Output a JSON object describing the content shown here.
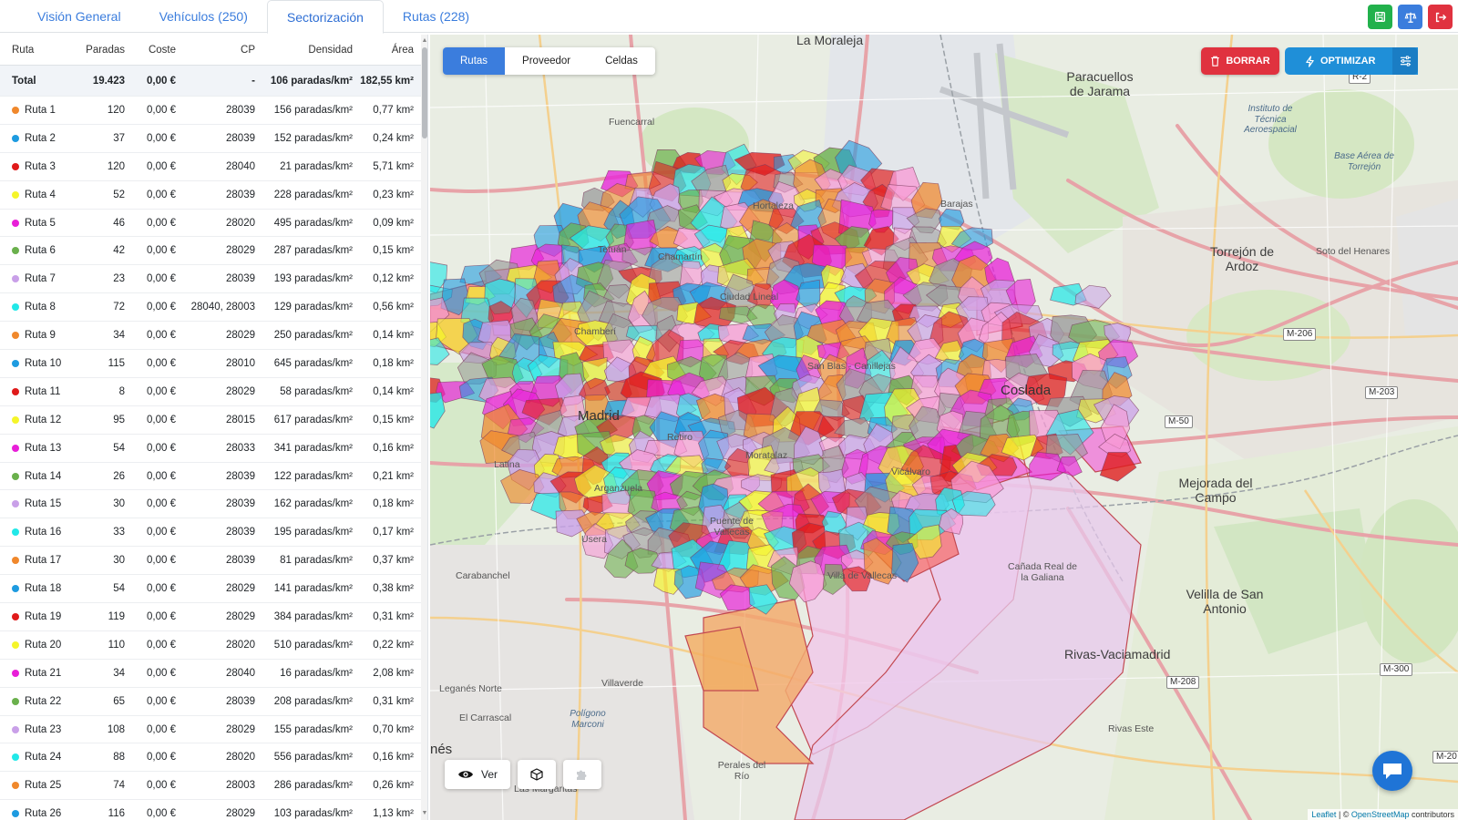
{
  "tabs": [
    {
      "label": "Visión General"
    },
    {
      "label": "Vehículos (250)"
    },
    {
      "label": "Sectorización"
    },
    {
      "label": "Rutas (228)"
    }
  ],
  "top_actions": [
    {
      "icon": "save-icon",
      "color": "#22b14c"
    },
    {
      "icon": "scale-icon",
      "color": "#3b7ddd"
    },
    {
      "icon": "logout-icon",
      "color": "#e0323f"
    }
  ],
  "table": {
    "headers": {
      "ruta": "Ruta",
      "paradas": "Paradas",
      "coste": "Coste",
      "cp": "CP",
      "densidad": "Densidad",
      "area": "Área"
    },
    "total": {
      "ruta": "Total",
      "paradas": "19.423",
      "coste": "0,00 €",
      "cp": "-",
      "densidad": "106 paradas/km²",
      "area": "182,55 km²"
    },
    "rows": [
      {
        "ruta": "Ruta 1",
        "color": "#f0882c",
        "paradas": "120",
        "coste": "0,00 €",
        "cp": "28039",
        "densidad": "156 paradas/km²",
        "area": "0,77 km²"
      },
      {
        "ruta": "Ruta 2",
        "color": "#1e9be0",
        "paradas": "37",
        "coste": "0,00 €",
        "cp": "28039",
        "densidad": "152 paradas/km²",
        "area": "0,24 km²"
      },
      {
        "ruta": "Ruta 3",
        "color": "#e01a1a",
        "paradas": "120",
        "coste": "0,00 €",
        "cp": "28040",
        "densidad": "21 paradas/km²",
        "area": "5,71 km²"
      },
      {
        "ruta": "Ruta 4",
        "color": "#f5f52a",
        "paradas": "52",
        "coste": "0,00 €",
        "cp": "28039",
        "densidad": "228 paradas/km²",
        "area": "0,23 km²"
      },
      {
        "ruta": "Ruta 5",
        "color": "#e81fd8",
        "paradas": "46",
        "coste": "0,00 €",
        "cp": "28020",
        "densidad": "495 paradas/km²",
        "area": "0,09 km²"
      },
      {
        "ruta": "Ruta 6",
        "color": "#6ab04c",
        "paradas": "42",
        "coste": "0,00 €",
        "cp": "28029",
        "densidad": "287 paradas/km²",
        "area": "0,15 km²"
      },
      {
        "ruta": "Ruta 7",
        "color": "#c9a0e8",
        "paradas": "23",
        "coste": "0,00 €",
        "cp": "28039",
        "densidad": "193 paradas/km²",
        "area": "0,12 km²"
      },
      {
        "ruta": "Ruta 8",
        "color": "#22e8e8",
        "paradas": "72",
        "coste": "0,00 €",
        "cp": "28040, 28003",
        "densidad": "129 paradas/km²",
        "area": "0,56 km²"
      },
      {
        "ruta": "Ruta 9",
        "color": "#f0882c",
        "paradas": "34",
        "coste": "0,00 €",
        "cp": "28029",
        "densidad": "250 paradas/km²",
        "area": "0,14 km²"
      },
      {
        "ruta": "Ruta 10",
        "color": "#1e9be0",
        "paradas": "115",
        "coste": "0,00 €",
        "cp": "28010",
        "densidad": "645 paradas/km²",
        "area": "0,18 km²"
      },
      {
        "ruta": "Ruta 11",
        "color": "#e01a1a",
        "paradas": "8",
        "coste": "0,00 €",
        "cp": "28029",
        "densidad": "58 paradas/km²",
        "area": "0,14 km²"
      },
      {
        "ruta": "Ruta 12",
        "color": "#f5f52a",
        "paradas": "95",
        "coste": "0,00 €",
        "cp": "28015",
        "densidad": "617 paradas/km²",
        "area": "0,15 km²"
      },
      {
        "ruta": "Ruta 13",
        "color": "#e81fd8",
        "paradas": "54",
        "coste": "0,00 €",
        "cp": "28033",
        "densidad": "341 paradas/km²",
        "area": "0,16 km²"
      },
      {
        "ruta": "Ruta 14",
        "color": "#6ab04c",
        "paradas": "26",
        "coste": "0,00 €",
        "cp": "28039",
        "densidad": "122 paradas/km²",
        "area": "0,21 km²"
      },
      {
        "ruta": "Ruta 15",
        "color": "#c9a0e8",
        "paradas": "30",
        "coste": "0,00 €",
        "cp": "28039",
        "densidad": "162 paradas/km²",
        "area": "0,18 km²"
      },
      {
        "ruta": "Ruta 16",
        "color": "#22e8e8",
        "paradas": "33",
        "coste": "0,00 €",
        "cp": "28039",
        "densidad": "195 paradas/km²",
        "area": "0,17 km²"
      },
      {
        "ruta": "Ruta 17",
        "color": "#f0882c",
        "paradas": "30",
        "coste": "0,00 €",
        "cp": "28039",
        "densidad": "81 paradas/km²",
        "area": "0,37 km²"
      },
      {
        "ruta": "Ruta 18",
        "color": "#1e9be0",
        "paradas": "54",
        "coste": "0,00 €",
        "cp": "28029",
        "densidad": "141 paradas/km²",
        "area": "0,38 km²"
      },
      {
        "ruta": "Ruta 19",
        "color": "#e01a1a",
        "paradas": "119",
        "coste": "0,00 €",
        "cp": "28029",
        "densidad": "384 paradas/km²",
        "area": "0,31 km²"
      },
      {
        "ruta": "Ruta 20",
        "color": "#f5f52a",
        "paradas": "110",
        "coste": "0,00 €",
        "cp": "28020",
        "densidad": "510 paradas/km²",
        "area": "0,22 km²"
      },
      {
        "ruta": "Ruta 21",
        "color": "#e81fd8",
        "paradas": "34",
        "coste": "0,00 €",
        "cp": "28040",
        "densidad": "16 paradas/km²",
        "area": "2,08 km²"
      },
      {
        "ruta": "Ruta 22",
        "color": "#6ab04c",
        "paradas": "65",
        "coste": "0,00 €",
        "cp": "28039",
        "densidad": "208 paradas/km²",
        "area": "0,31 km²"
      },
      {
        "ruta": "Ruta 23",
        "color": "#c9a0e8",
        "paradas": "108",
        "coste": "0,00 €",
        "cp": "28029",
        "densidad": "155 paradas/km²",
        "area": "0,70 km²"
      },
      {
        "ruta": "Ruta 24",
        "color": "#22e8e8",
        "paradas": "88",
        "coste": "0,00 €",
        "cp": "28020",
        "densidad": "556 paradas/km²",
        "area": "0,16 km²"
      },
      {
        "ruta": "Ruta 25",
        "color": "#f0882c",
        "paradas": "74",
        "coste": "0,00 €",
        "cp": "28003",
        "densidad": "286 paradas/km²",
        "area": "0,26 km²"
      },
      {
        "ruta": "Ruta 26",
        "color": "#1e9be0",
        "paradas": "116",
        "coste": "0,00 €",
        "cp": "28029",
        "densidad": "103 paradas/km²",
        "area": "1,13 km²"
      }
    ]
  },
  "map": {
    "view_toggle": [
      {
        "label": "Rutas"
      },
      {
        "label": "Proveedor"
      },
      {
        "label": "Celdas"
      }
    ],
    "borrar_label": "BORRAR",
    "optimizar_label": "OPTIMIZAR",
    "ver_label": "Ver",
    "attribution": {
      "leaflet": "Leaflet",
      "sep": " | © ",
      "osm": "OpenStreetMap",
      "suffix": " contributors"
    },
    "places": [
      {
        "name": "La Moraleja",
        "cls": "city"
      },
      {
        "name": "Paracuellos de Jarama",
        "cls": "city"
      },
      {
        "name": "Instituto de Técnica Aeroespacial",
        "cls": "ital"
      },
      {
        "name": "Base Aérea de Torrejón",
        "cls": "ital"
      },
      {
        "name": "Fuencarral",
        "cls": "small"
      },
      {
        "name": "Barajas",
        "cls": "small"
      },
      {
        "name": "Torrejón de Ardoz",
        "cls": "city"
      },
      {
        "name": "Soto del Henares",
        "cls": "small"
      },
      {
        "name": "Hortaleza",
        "cls": "small"
      },
      {
        "name": "Tetuán",
        "cls": "small"
      },
      {
        "name": "Chamartín",
        "cls": "small"
      },
      {
        "name": "Ciudad Lineal",
        "cls": "small"
      },
      {
        "name": "Chamberí",
        "cls": "small"
      },
      {
        "name": "San Blas - Canillejas",
        "cls": "small"
      },
      {
        "name": "Coslada",
        "cls": "big"
      },
      {
        "name": "Madrid",
        "cls": "big"
      },
      {
        "name": "Retiro",
        "cls": "small"
      },
      {
        "name": "Latina",
        "cls": "small"
      },
      {
        "name": "Moratalaz",
        "cls": "small"
      },
      {
        "name": "Vicálvaro",
        "cls": "small"
      },
      {
        "name": "Mejorada del Campo",
        "cls": "city"
      },
      {
        "name": "Arganzuela",
        "cls": "small"
      },
      {
        "name": "Puente de Vallecas",
        "cls": "small"
      },
      {
        "name": "Usera",
        "cls": "small"
      },
      {
        "name": "Carabanchel",
        "cls": "small"
      },
      {
        "name": "Villa de Vallecas",
        "cls": "small"
      },
      {
        "name": "Cañada Real de la Galiana",
        "cls": "small"
      },
      {
        "name": "Velilla de San Antonio",
        "cls": "city"
      },
      {
        "name": "Rivas-Vaciamadrid",
        "cls": "city"
      },
      {
        "name": "Villaverde",
        "cls": "small"
      },
      {
        "name": "Leganés Norte",
        "cls": "small"
      },
      {
        "name": "El Carrascal",
        "cls": "small"
      },
      {
        "name": "Polígono Marconi",
        "cls": "ital"
      },
      {
        "name": "Rivas Este",
        "cls": "small"
      },
      {
        "name": "Perales del Río",
        "cls": "small"
      },
      {
        "name": "Las Margaritas",
        "cls": "small"
      },
      {
        "name": "nés",
        "cls": "big"
      }
    ],
    "road_labels": [
      "M-206",
      "M-203",
      "M-50",
      "M-208",
      "M-300",
      "R-2",
      "M-20"
    ]
  }
}
